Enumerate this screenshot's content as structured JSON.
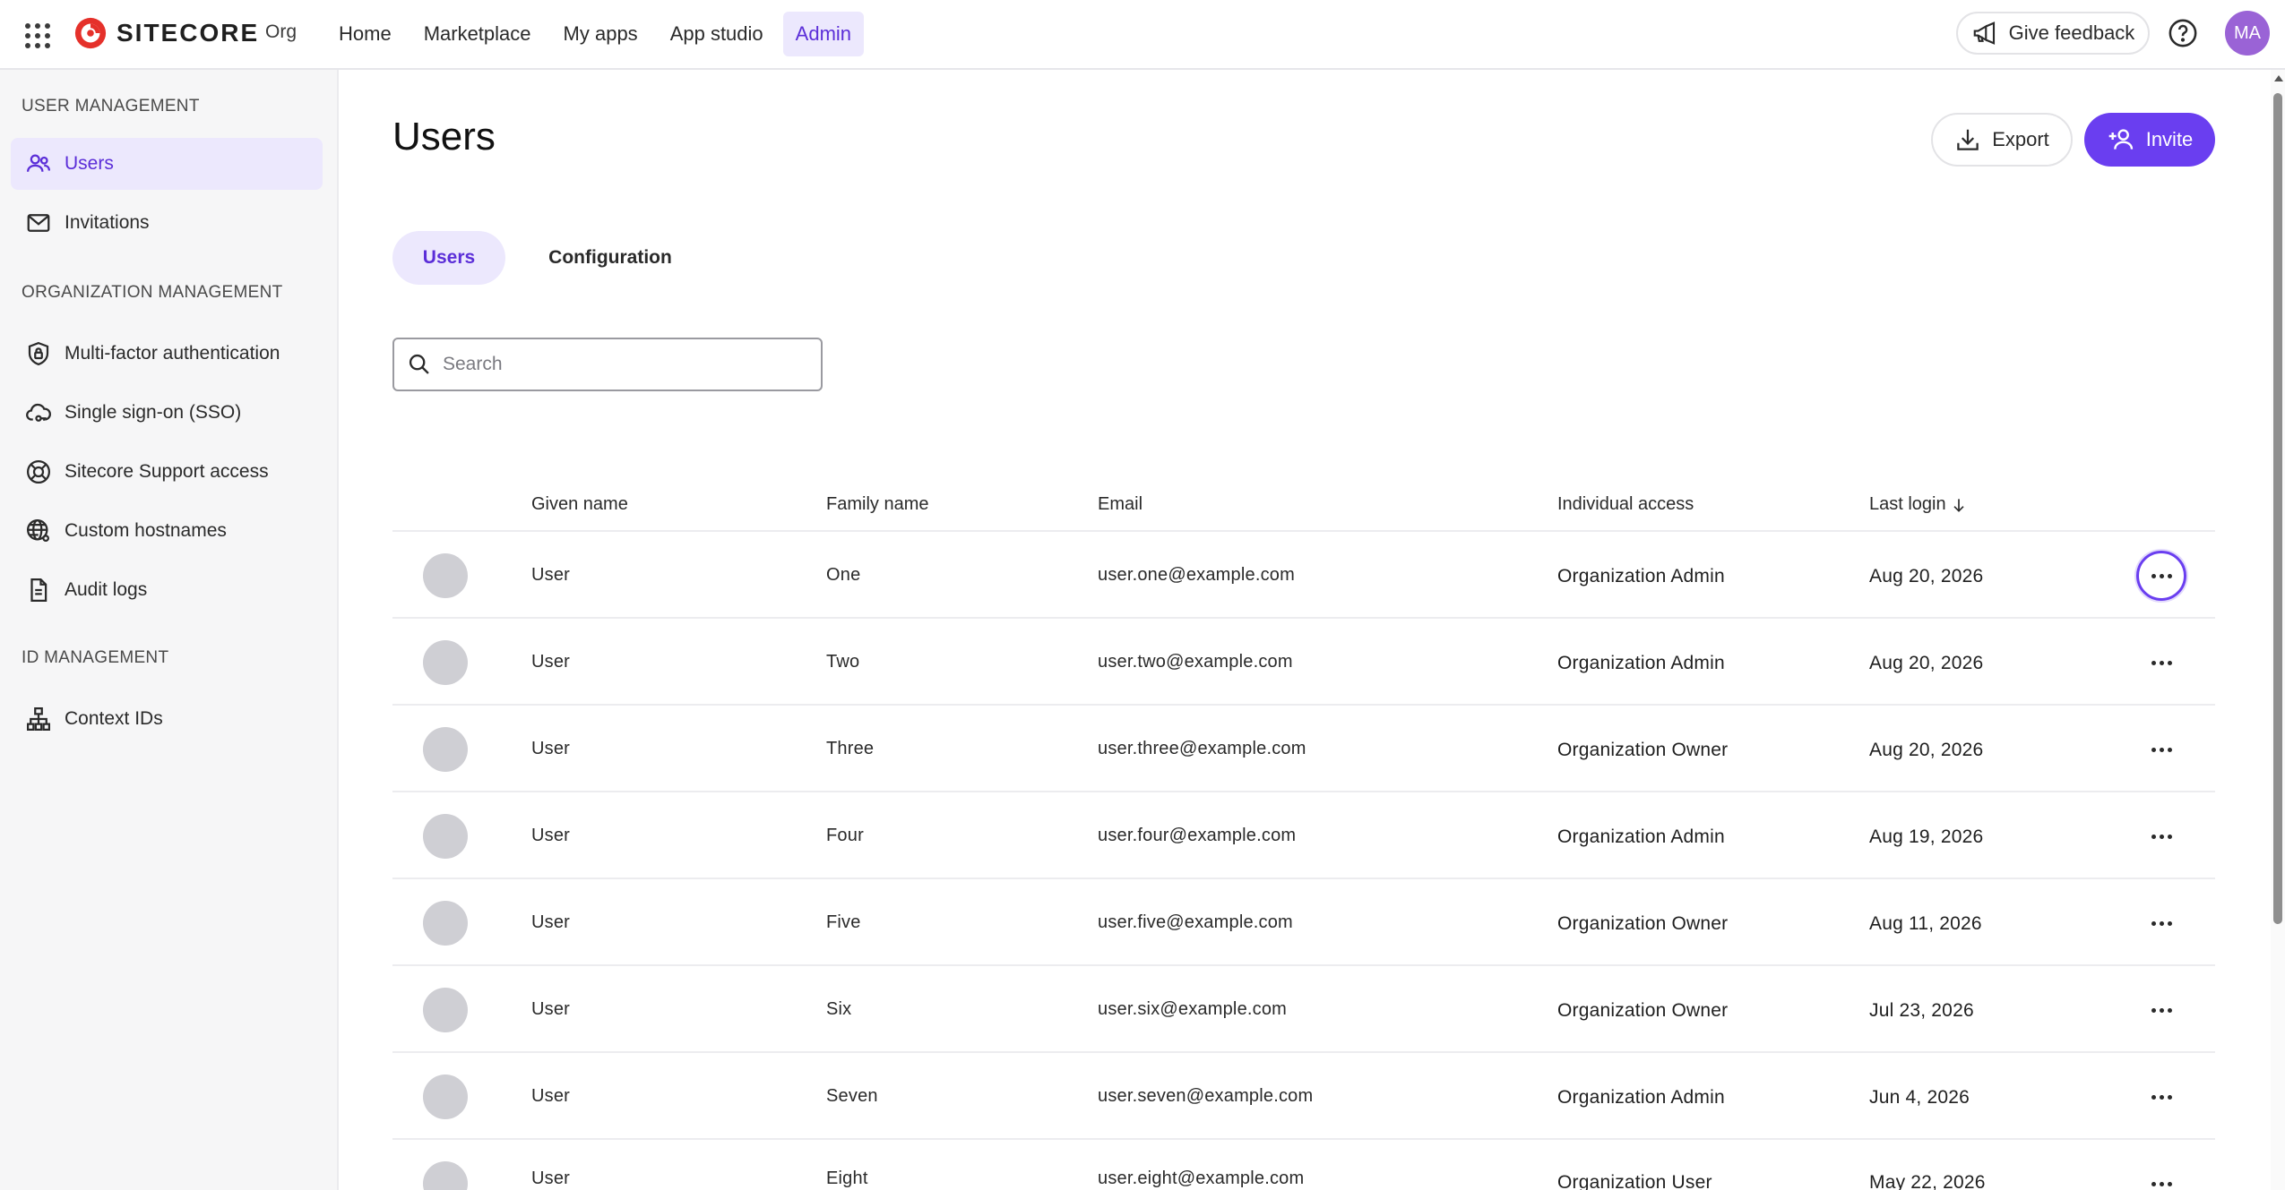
{
  "topbar": {
    "brand": "SITECORE",
    "org": "Org",
    "nav": [
      {
        "label": "Home",
        "active": false
      },
      {
        "label": "Marketplace",
        "active": false
      },
      {
        "label": "My apps",
        "active": false
      },
      {
        "label": "App studio",
        "active": false
      },
      {
        "label": "Admin",
        "active": true
      }
    ],
    "feedback_label": "Give feedback",
    "avatar_initials": "MA",
    "icons": {
      "apps": "apps-grid-icon",
      "feedback": "megaphone-icon",
      "help": "help-circle-icon"
    }
  },
  "sidebar": {
    "sections": [
      {
        "title": "USER MANAGEMENT",
        "items": [
          {
            "label": "Users",
            "icon": "users-icon",
            "active": true
          },
          {
            "label": "Invitations",
            "icon": "envelope-icon",
            "active": false
          }
        ]
      },
      {
        "title": "ORGANIZATION MANAGEMENT",
        "items": [
          {
            "label": "Multi-factor authentication",
            "icon": "shield-lock-icon",
            "active": false
          },
          {
            "label": "Single sign-on (SSO)",
            "icon": "cloud-key-icon",
            "active": false
          },
          {
            "label": "Sitecore Support access",
            "icon": "lifebuoy-icon",
            "active": false
          },
          {
            "label": "Custom hostnames",
            "icon": "globe-icon",
            "active": false
          },
          {
            "label": "Audit logs",
            "icon": "document-icon",
            "active": false
          }
        ]
      },
      {
        "title": "ID MANAGEMENT",
        "items": [
          {
            "label": "Context IDs",
            "icon": "hierarchy-icon",
            "active": false
          }
        ]
      }
    ]
  },
  "main": {
    "title": "Users",
    "export_label": "Export",
    "invite_label": "Invite",
    "tabs": [
      {
        "label": "Users",
        "active": true
      },
      {
        "label": "Configuration",
        "active": false
      }
    ],
    "search": {
      "placeholder": "Search",
      "value": ""
    },
    "table": {
      "columns": [
        "Given name",
        "Family name",
        "Email",
        "Individual access",
        "Last login"
      ],
      "sort": {
        "column": "Last login",
        "direction": "descending"
      },
      "rows": [
        {
          "given": "User",
          "family": "One",
          "email": "user.one@example.com",
          "access": "Organization Admin",
          "last_login": "Aug 20, 2026"
        },
        {
          "given": "User",
          "family": "Two",
          "email": "user.two@example.com",
          "access": "Organization Admin",
          "last_login": "Aug 20, 2026"
        },
        {
          "given": "User",
          "family": "Three",
          "email": "user.three@example.com",
          "access": "Organization Owner",
          "last_login": "Aug 20, 2026"
        },
        {
          "given": "User",
          "family": "Four",
          "email": "user.four@example.com",
          "access": "Organization Admin",
          "last_login": "Aug 19, 2026"
        },
        {
          "given": "User",
          "family": "Five",
          "email": "user.five@example.com",
          "access": "Organization Owner",
          "last_login": "Aug 11, 2026"
        },
        {
          "given": "User",
          "family": "Six",
          "email": "user.six@example.com",
          "access": "Organization Owner",
          "last_login": "Jul 23, 2026"
        },
        {
          "given": "User",
          "family": "Seven",
          "email": "user.seven@example.com",
          "access": "Organization Admin",
          "last_login": "Jun 4, 2026"
        },
        {
          "given": "User",
          "family": "Eight",
          "email": "user.eight@example.com",
          "access": "Organization User",
          "last_login": "May 22, 2026"
        }
      ]
    }
  },
  "colors": {
    "accent": "#6a3ef0",
    "accent_soft": "#ece8fd",
    "brand_red": "#e5312b",
    "avatar": "#9a63d6"
  }
}
